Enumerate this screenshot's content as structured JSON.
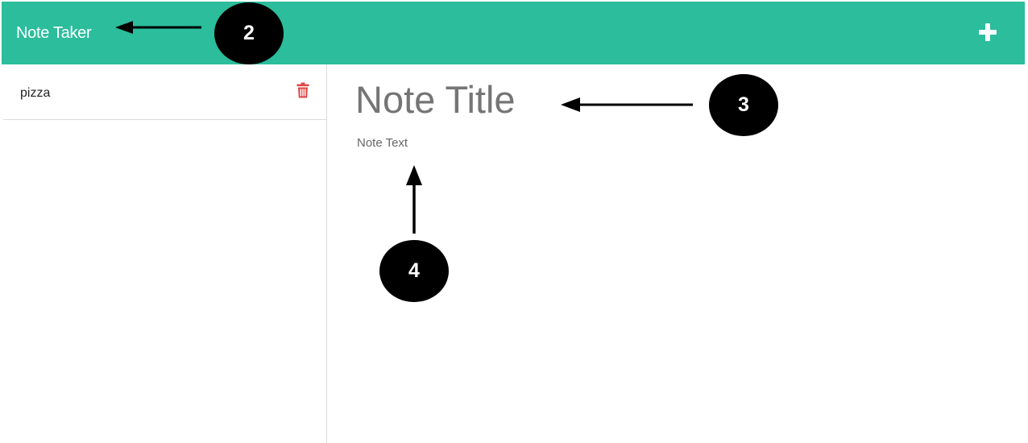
{
  "navbar": {
    "brand": "Note Taker",
    "new_note_icon": "plus-icon",
    "background_color": "#2bbd9c"
  },
  "sidebar": {
    "notes": [
      {
        "title": "pizza",
        "delete_icon": "trash-icon",
        "delete_icon_color": "#e04848"
      }
    ]
  },
  "editor": {
    "title_placeholder": "Note Title",
    "text_placeholder": "Note Text"
  },
  "annotations": {
    "callouts": [
      "2",
      "3",
      "4"
    ]
  }
}
